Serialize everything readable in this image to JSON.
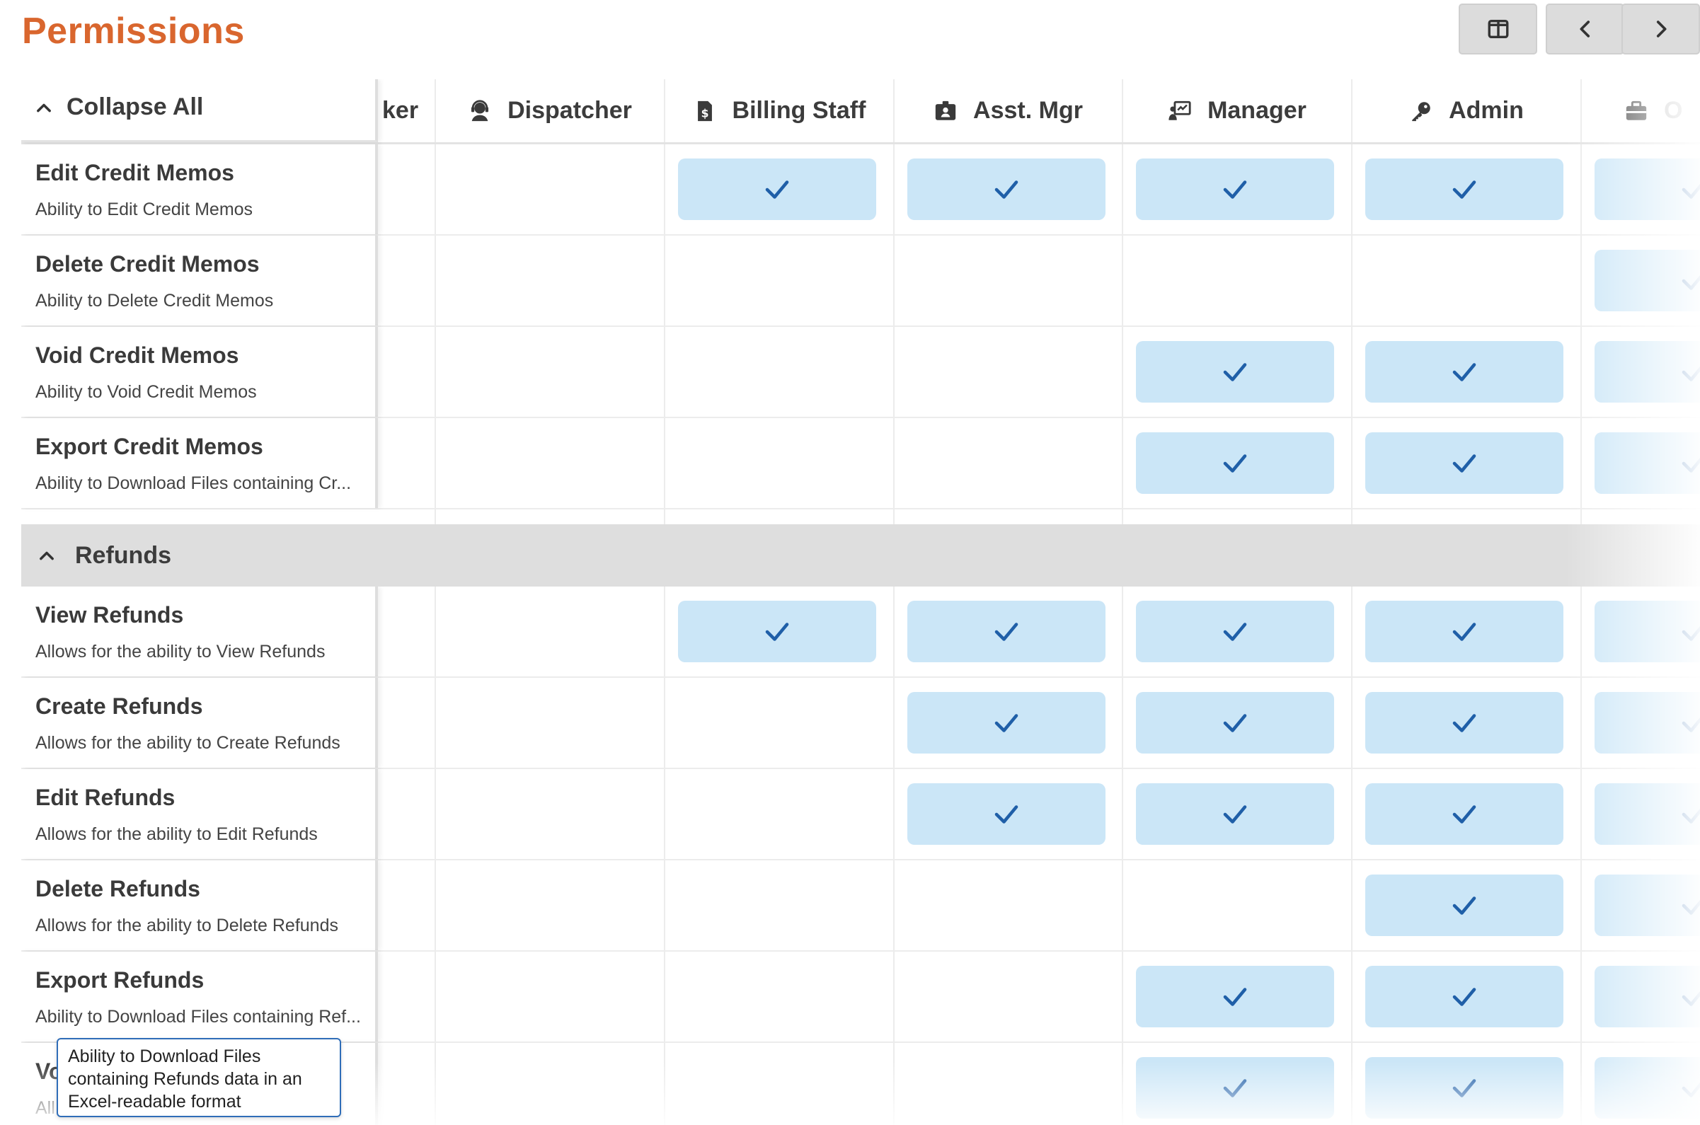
{
  "page_title": "Permissions",
  "toolbar": {
    "layout_icon": "columns-icon",
    "prev_icon": "chevron-left-icon",
    "next_icon": "chevron-right-icon"
  },
  "header": {
    "collapse_label": "Collapse All",
    "columns": [
      {
        "label": "ker",
        "icon": "partial"
      },
      {
        "label": "Dispatcher",
        "icon": "headset-icon"
      },
      {
        "label": "Billing Staff",
        "icon": "invoice-icon"
      },
      {
        "label": "Asst. Mgr",
        "icon": "id-badge-icon"
      },
      {
        "label": "Manager",
        "icon": "presenter-icon"
      },
      {
        "label": "Admin",
        "icon": "key-icon"
      },
      {
        "label": "O",
        "icon": "briefcase-icon"
      }
    ]
  },
  "sections": {
    "credit_memos": [
      {
        "title": "Edit Credit Memos",
        "desc": "Ability to Edit Credit Memos",
        "checks": [
          false,
          false,
          true,
          true,
          true,
          true,
          true
        ]
      },
      {
        "title": "Delete Credit Memos",
        "desc": "Ability to Delete Credit Memos",
        "checks": [
          false,
          false,
          false,
          false,
          false,
          false,
          true
        ]
      },
      {
        "title": "Void Credit Memos",
        "desc": "Ability to Void Credit Memos",
        "checks": [
          false,
          false,
          false,
          false,
          true,
          true,
          true
        ]
      },
      {
        "title": "Export Credit Memos",
        "desc": "Ability to Download Files containing Cr...",
        "checks": [
          false,
          false,
          false,
          false,
          true,
          true,
          true
        ]
      }
    ],
    "refunds_group_label": "Refunds",
    "refunds": [
      {
        "title": "View Refunds",
        "desc": "Allows for the ability to View Refunds",
        "checks": [
          false,
          false,
          true,
          true,
          true,
          true,
          true
        ]
      },
      {
        "title": "Create Refunds",
        "desc": "Allows for the ability to Create Refunds",
        "checks": [
          false,
          false,
          false,
          true,
          true,
          true,
          true
        ]
      },
      {
        "title": "Edit Refunds",
        "desc": "Allows for the ability to Edit Refunds",
        "checks": [
          false,
          false,
          false,
          true,
          true,
          true,
          true
        ]
      },
      {
        "title": "Delete Refunds",
        "desc": "Allows for the ability to Delete Refunds",
        "checks": [
          false,
          false,
          false,
          false,
          false,
          true,
          true
        ]
      },
      {
        "title": "Export Refunds",
        "desc": "Ability to Download Files containing Ref...",
        "checks": [
          false,
          false,
          false,
          false,
          true,
          true,
          true
        ]
      },
      {
        "title": "Vo",
        "desc": "All",
        "checks": [
          false,
          false,
          false,
          false,
          true,
          true,
          true
        ]
      }
    ]
  },
  "tooltip": {
    "text": "Ability to Download Files containing Refunds data in an Excel-readable format"
  }
}
